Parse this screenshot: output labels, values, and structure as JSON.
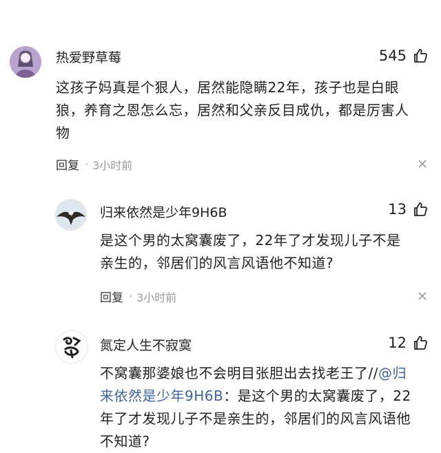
{
  "colors": {
    "text": "#222222",
    "meta": "#9a9a9a",
    "mention": "#406599"
  },
  "comments": [
    {
      "name": "热爱野草莓",
      "likes": "545",
      "lines": [
        "这孩子妈真是个狠人，居然能隐瞒22年，孩子也是白眼",
        "狼，养育之恩怎么忘，居然和父亲反目成仇，都是厉害人",
        "物"
      ],
      "reply_label": "回复",
      "dot": "·",
      "time": "3小时前"
    },
    {
      "name": "归来依然是少年9H6B",
      "likes": "13",
      "lines": [
        "是这个男的太窝囊废了，22年了才发现儿子不是",
        "亲生的，邻居们的风言风语他不知道?"
      ],
      "reply_label": "回复",
      "dot": "·",
      "time": "3小时前"
    },
    {
      "name": "氮定人生不寂寞",
      "likes": "12",
      "line1_text": "不窝囊那婆娘也不会明目张胆出去找老王了//",
      "line1_mention": "@归",
      "line2_mention": "来依然是少年9H6B",
      "line2_text": "：是这个男的太窝囊废了，22",
      "line3_text": "年了才发现儿子不是亲生的，邻居们的风言风语他",
      "line4_text": "不知道?"
    }
  ]
}
